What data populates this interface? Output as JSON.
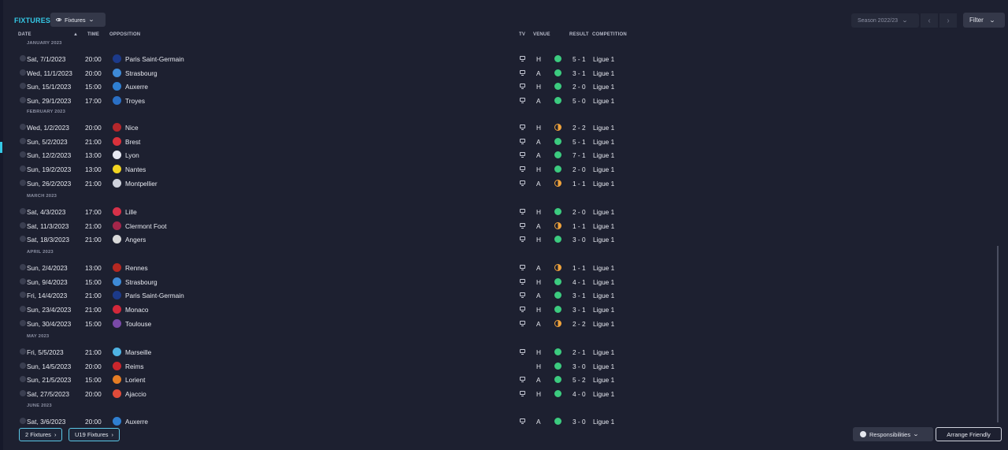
{
  "header": {
    "title": "FIXTURES",
    "view_select": "Fixtures",
    "season": "Season 2022/23",
    "filter": "Filter"
  },
  "columns": {
    "date": "DATE",
    "time": "TIME",
    "opposition": "OPPOSITION",
    "tv": "TV",
    "venue": "VENUE",
    "result": "RESULT",
    "competition": "COMPETITION"
  },
  "months": [
    "JANUARY 2023",
    "FEBRUARY 2023",
    "MARCH 2023",
    "APRIL 2023",
    "MAY 2023",
    "JUNE 2023"
  ],
  "fixtures": [
    {
      "date": "Sat, 7/1/2023",
      "time": "20:00",
      "team": "Paris Saint-Germain",
      "crest": "#1c3a8a",
      "tv": true,
      "venue": "H",
      "outcome": "win",
      "result": "5 - 1",
      "comp": "Ligue 1"
    },
    {
      "date": "Wed, 11/1/2023",
      "time": "20:00",
      "team": "Strasbourg",
      "crest": "#3e8ad6",
      "tv": true,
      "venue": "A",
      "outcome": "win",
      "result": "3 - 1",
      "comp": "Ligue 1"
    },
    {
      "date": "Sun, 15/1/2023",
      "time": "15:00",
      "team": "Auxerre",
      "crest": "#2f7fd1",
      "tv": true,
      "venue": "H",
      "outcome": "win",
      "result": "2 - 0",
      "comp": "Ligue 1"
    },
    {
      "date": "Sun, 29/1/2023",
      "time": "17:00",
      "team": "Troyes",
      "crest": "#2a6fc4",
      "tv": true,
      "venue": "A",
      "outcome": "win",
      "result": "5 - 0",
      "comp": "Ligue 1"
    },
    {
      "date": "Wed, 1/2/2023",
      "time": "20:00",
      "team": "Nice",
      "crest": "#b5272b",
      "tv": true,
      "venue": "H",
      "outcome": "draw",
      "result": "2 - 2",
      "comp": "Ligue 1"
    },
    {
      "date": "Sun, 5/2/2023",
      "time": "21:00",
      "team": "Brest",
      "crest": "#d9313b",
      "tv": true,
      "venue": "A",
      "outcome": "win",
      "result": "5 - 1",
      "comp": "Ligue 1"
    },
    {
      "date": "Sun, 12/2/2023",
      "time": "13:00",
      "team": "Lyon",
      "crest": "#e7e9f2",
      "tv": true,
      "venue": "A",
      "outcome": "win",
      "result": "7 - 1",
      "comp": "Ligue 1"
    },
    {
      "date": "Sun, 19/2/2023",
      "time": "13:00",
      "team": "Nantes",
      "crest": "#f2d421",
      "tv": true,
      "venue": "H",
      "outcome": "win",
      "result": "2 - 0",
      "comp": "Ligue 1"
    },
    {
      "date": "Sun, 26/2/2023",
      "time": "21:00",
      "team": "Montpellier",
      "crest": "#cfd2dc",
      "tv": true,
      "venue": "A",
      "outcome": "draw",
      "result": "1 - 1",
      "comp": "Ligue 1"
    },
    {
      "date": "Sat, 4/3/2023",
      "time": "17:00",
      "team": "Lille",
      "crest": "#d63149",
      "tv": true,
      "venue": "H",
      "outcome": "win",
      "result": "2 - 0",
      "comp": "Ligue 1"
    },
    {
      "date": "Sat, 11/3/2023",
      "time": "21:00",
      "team": "Clermont Foot",
      "crest": "#a3264a",
      "tv": true,
      "venue": "A",
      "outcome": "draw",
      "result": "1 - 1",
      "comp": "Ligue 1"
    },
    {
      "date": "Sat, 18/3/2023",
      "time": "21:00",
      "team": "Angers",
      "crest": "#d9d9d9",
      "tv": true,
      "venue": "H",
      "outcome": "win",
      "result": "3 - 0",
      "comp": "Ligue 1"
    },
    {
      "date": "Sun, 2/4/2023",
      "time": "13:00",
      "team": "Rennes",
      "crest": "#b52821",
      "tv": true,
      "venue": "A",
      "outcome": "draw",
      "result": "1 - 1",
      "comp": "Ligue 1"
    },
    {
      "date": "Sun, 9/4/2023",
      "time": "15:00",
      "team": "Strasbourg",
      "crest": "#3e8ad6",
      "tv": true,
      "venue": "H",
      "outcome": "win",
      "result": "4 - 1",
      "comp": "Ligue 1"
    },
    {
      "date": "Fri, 14/4/2023",
      "time": "21:00",
      "team": "Paris Saint-Germain",
      "crest": "#1c3a8a",
      "tv": true,
      "venue": "A",
      "outcome": "win",
      "result": "3 - 1",
      "comp": "Ligue 1"
    },
    {
      "date": "Sun, 23/4/2023",
      "time": "21:00",
      "team": "Monaco",
      "crest": "#d3283a",
      "tv": true,
      "venue": "H",
      "outcome": "win",
      "result": "3 - 1",
      "comp": "Ligue 1"
    },
    {
      "date": "Sun, 30/4/2023",
      "time": "15:00",
      "team": "Toulouse",
      "crest": "#7a4aa8",
      "tv": true,
      "venue": "A",
      "outcome": "draw",
      "result": "2 - 2",
      "comp": "Ligue 1"
    },
    {
      "date": "Fri, 5/5/2023",
      "time": "21:00",
      "team": "Marseille",
      "crest": "#4fb3e3",
      "tv": true,
      "venue": "H",
      "outcome": "win",
      "result": "2 - 1",
      "comp": "Ligue 1"
    },
    {
      "date": "Sun, 14/5/2023",
      "time": "20:00",
      "team": "Reims",
      "crest": "#c9262c",
      "tv": false,
      "venue": "H",
      "outcome": "win",
      "result": "3 - 0",
      "comp": "Ligue 1"
    },
    {
      "date": "Sun, 21/5/2023",
      "time": "15:00",
      "team": "Lorient",
      "crest": "#e57d24",
      "tv": true,
      "venue": "A",
      "outcome": "win",
      "result": "5 - 2",
      "comp": "Ligue 1"
    },
    {
      "date": "Sat, 27/5/2023",
      "time": "20:00",
      "team": "Ajaccio",
      "crest": "#e04b3a",
      "tv": true,
      "venue": "H",
      "outcome": "win",
      "result": "4 - 0",
      "comp": "Ligue 1"
    },
    {
      "date": "Sat, 3/6/2023",
      "time": "20:00",
      "team": "Auxerre",
      "crest": "#2f7fd1",
      "tv": true,
      "venue": "A",
      "outcome": "win",
      "result": "3 - 0",
      "comp": "Ligue 1"
    }
  ],
  "footer": {
    "fixtures2": "2 Fixtures",
    "u19": "U19 Fixtures",
    "responsibilities": "Responsibilities",
    "arrange": "Arrange Friendly"
  }
}
